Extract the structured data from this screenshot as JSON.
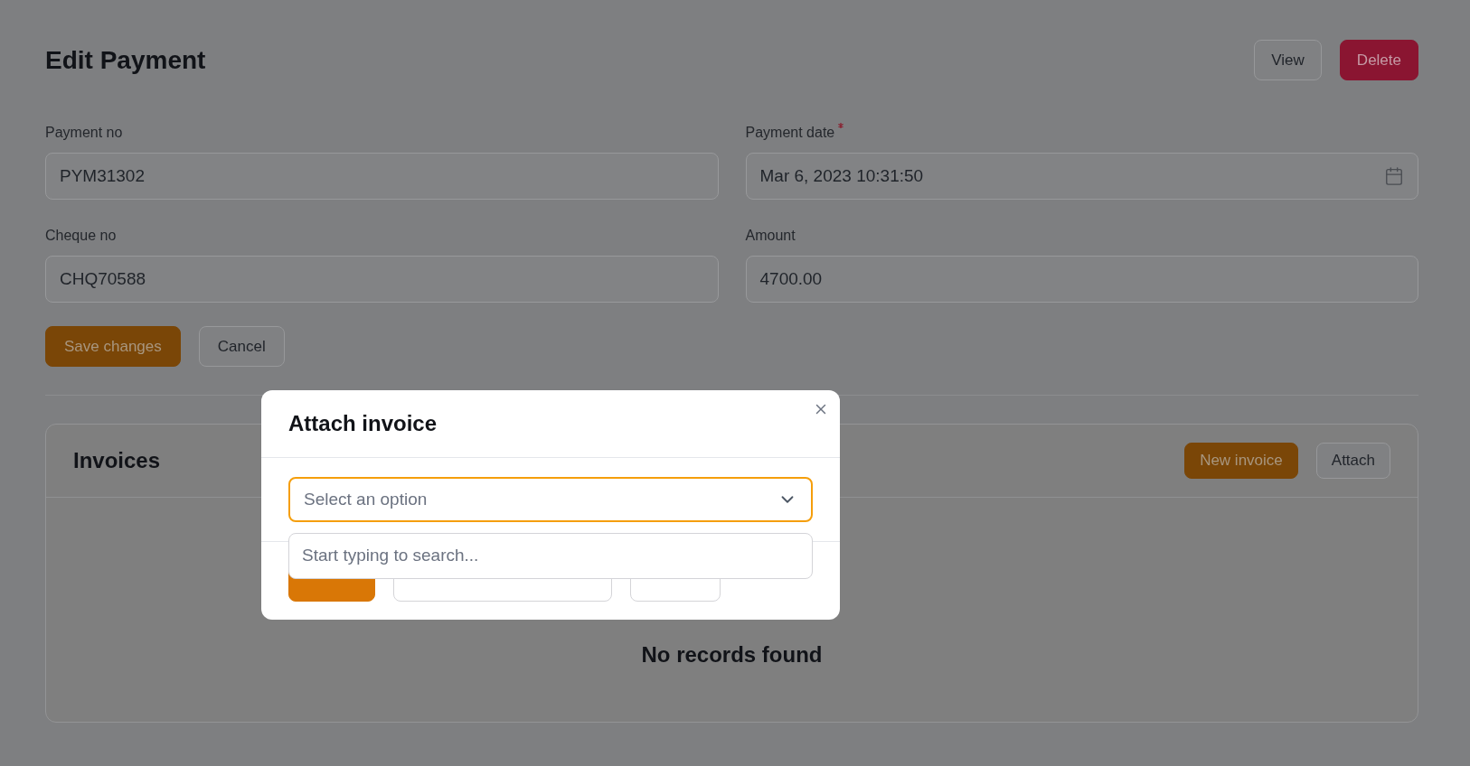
{
  "page": {
    "title": "Edit Payment",
    "actions": [
      {
        "label": "View",
        "kind": "secondary"
      },
      {
        "label": "Delete",
        "kind": "danger"
      }
    ]
  },
  "form": {
    "fields": [
      {
        "label": "Payment no",
        "value": "PYM31302",
        "required": false,
        "kind": "text"
      },
      {
        "label": "Payment date",
        "value": "Mar 6, 2023 10:31:50",
        "required": true,
        "kind": "date"
      },
      {
        "label": "Cheque no",
        "value": "CHQ70588",
        "required": false,
        "kind": "text"
      },
      {
        "label": "Amount",
        "value": "4700.00",
        "required": false,
        "kind": "text"
      }
    ],
    "buttons": [
      {
        "label": "Save changes",
        "kind": "primary"
      },
      {
        "label": "Cancel",
        "kind": "secondary"
      }
    ]
  },
  "invoices": {
    "title": "Invoices",
    "buttons": [
      {
        "label": "New invoice",
        "kind": "primary"
      },
      {
        "label": "Attach",
        "kind": "secondary"
      }
    ],
    "empty_message": "No records found"
  },
  "modal": {
    "title": "Attach invoice",
    "select": {
      "placeholder": "Select an option",
      "expanded": true
    },
    "search": {
      "placeholder": "Start typing to search..."
    },
    "buttons": [
      {
        "kind": "primary"
      },
      {
        "kind": "secondary"
      },
      {
        "kind": "secondary"
      }
    ]
  }
}
